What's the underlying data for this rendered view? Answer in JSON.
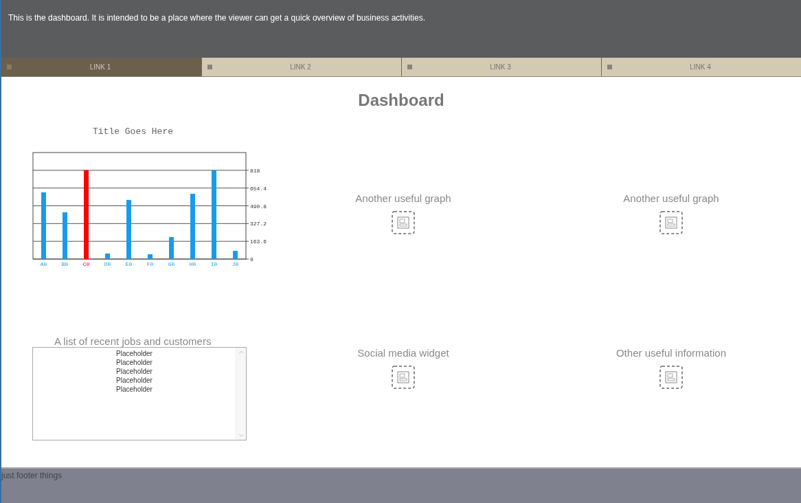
{
  "header": {
    "text": "This is the dashboard. It is intended to be a place where the viewer can get a quick overview of business activities."
  },
  "nav": [
    {
      "label": "LINK 1",
      "selected": true
    },
    {
      "label": "LINK 2",
      "selected": false
    },
    {
      "label": "LINK 3",
      "selected": false
    },
    {
      "label": "LINK 4",
      "selected": false
    }
  ],
  "title": "Dashboard",
  "chart": {
    "chart_data": {
      "type": "bar",
      "title": "Title Goes Here",
      "categories": [
        "A0",
        "B0",
        "C0",
        "D0",
        "E0",
        "F0",
        "G0",
        "H0",
        "I0",
        "J0"
      ],
      "series": [
        {
          "color": "#1a9be8",
          "values": [
            615,
            431,
            null,
            51,
            545,
            44,
            203,
            602,
            818,
            76
          ]
        },
        {
          "color": "#ff0000",
          "values": [
            null,
            null,
            818,
            null,
            null,
            null,
            null,
            null,
            null,
            null
          ]
        }
      ],
      "ylim": [
        0,
        981.6
      ],
      "yticks": [
        0,
        163.6,
        327.2,
        490.8,
        654.4,
        818
      ],
      "grid": true
    }
  },
  "widgets": [
    {
      "title": "Another useful graph"
    },
    {
      "title": "Another useful graph"
    }
  ],
  "list": {
    "title": "A list of recent jobs and customers",
    "items": [
      "Placeholder",
      "Placeholder",
      "Placeholder",
      "Placeholder",
      "Placeholder"
    ]
  },
  "bottom_widgets": [
    {
      "title": "Social media widget"
    },
    {
      "title": "Other useful information"
    }
  ],
  "footer": {
    "text": "just footer things"
  }
}
